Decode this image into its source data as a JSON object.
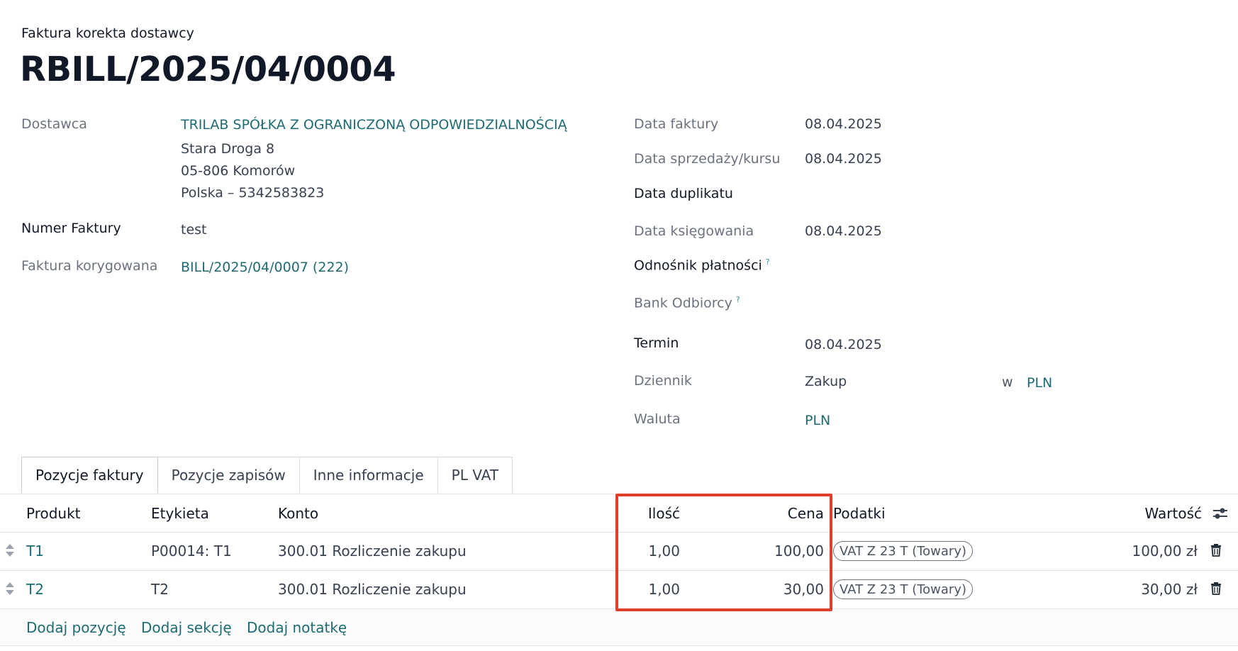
{
  "header": {
    "subtitle": "Faktura korekta dostawcy",
    "title": "RBILL/2025/04/0004"
  },
  "left_fields": {
    "vendor_label": "Dostawca",
    "vendor_name": "TRILAB SPÓŁKA Z OGRANICZONĄ ODPOWIEDZIALNOŚCIĄ",
    "vendor_address_1": "Stara Droga 8",
    "vendor_address_2": "05-806 Komorów",
    "vendor_address_3": "Polska – 5342583823",
    "invoice_number_label": "Numer Faktury",
    "invoice_number_value": "test",
    "corrected_invoice_label": "Faktura korygowana",
    "corrected_invoice_value": "BILL/2025/04/0007 (222)"
  },
  "right_fields": {
    "invoice_date_label": "Data faktury",
    "invoice_date_value": "08.04.2025",
    "sale_date_label": "Data sprzedaży/kursu",
    "sale_date_value": "08.04.2025",
    "duplicate_date_label": "Data duplikatu",
    "accounting_date_label": "Data księgowania",
    "accounting_date_value": "08.04.2025",
    "payment_ref_label": "Odnośnik płatności",
    "bank_label": "Bank Odbiorcy",
    "due_label": "Termin",
    "due_value": "08.04.2025",
    "journal_label": "Dziennik",
    "journal_value": "Zakup",
    "journal_in": "w",
    "journal_currency": "PLN",
    "currency_label": "Waluta",
    "currency_value": "PLN",
    "help_mark": "?"
  },
  "tabs": [
    {
      "label": "Pozycje faktury",
      "active": true
    },
    {
      "label": "Pozycje zapisów",
      "active": false
    },
    {
      "label": "Inne informacje",
      "active": false
    },
    {
      "label": "PL VAT",
      "active": false
    }
  ],
  "table": {
    "headers": {
      "product": "Produkt",
      "label": "Etykieta",
      "account": "Konto",
      "quantity": "Ilość",
      "price": "Cena",
      "taxes": "Podatki",
      "amount": "Wartość"
    },
    "rows": [
      {
        "product": "T1",
        "label": "P00014: T1",
        "account": "300.01 Rozliczenie zakupu",
        "quantity": "1,00",
        "price": "100,00",
        "tax": "VAT Z 23 T (Towary)",
        "amount": "100,00 zł"
      },
      {
        "product": "T2",
        "label": "T2",
        "account": "300.01 Rozliczenie zakupu",
        "quantity": "1,00",
        "price": "30,00",
        "tax": "VAT Z 23 T (Towary)",
        "amount": "30,00 zł"
      }
    ],
    "add_line": "Dodaj pozycję",
    "add_section": "Dodaj sekcję",
    "add_note": "Dodaj notatkę"
  },
  "colors": {
    "link": "#1d6b74",
    "highlight_box": "#e03e2d"
  }
}
